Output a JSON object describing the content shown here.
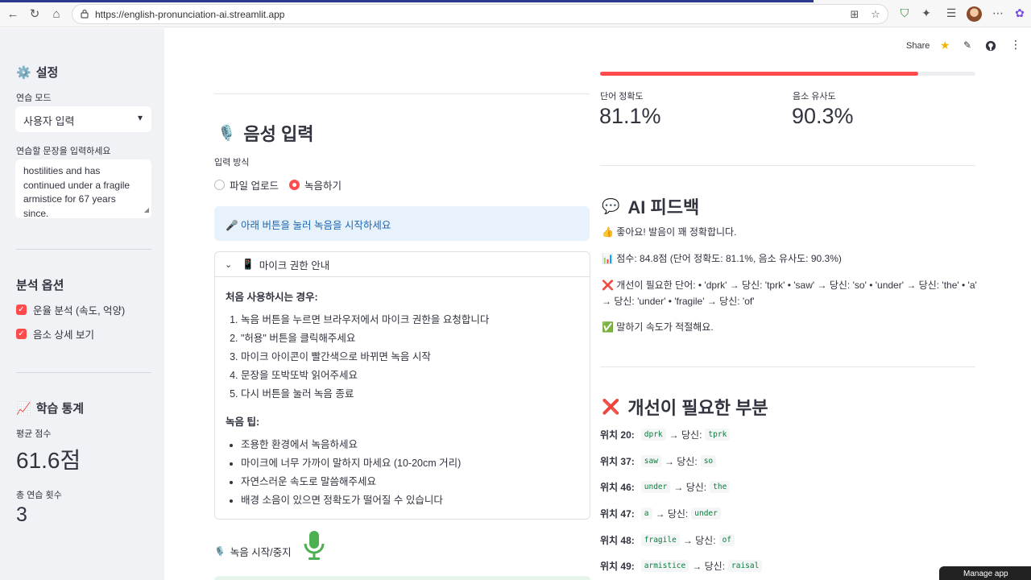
{
  "browser": {
    "url": "https://english-pronunciation-ai.streamlit.app"
  },
  "sidebar": {
    "settings_title": "설정",
    "mode_label": "연습 모드",
    "mode_value": "사용자 입력",
    "sentence_label": "연습할 문장을 입력하세요",
    "sentence_value": "hostilities and has continued under a fragile armistice for 67 years since.",
    "analysis_title": "분석 옵션",
    "options": [
      "운율 분석 (속도, 억양)",
      "음소 상세 보기"
    ],
    "stats_title": "학습 통계",
    "avg_label": "평균 점수",
    "avg_value": "61.6점",
    "count_label": "총 연습 횟수",
    "count_value": "3"
  },
  "header": {
    "share": "Share"
  },
  "voice": {
    "title": "음성 입력",
    "method_label": "입력 방식",
    "options": [
      "파일 업로드",
      "녹음하기"
    ],
    "selected": "녹음하기",
    "info": "🎤 아래 버튼을 눌러 녹음을 시작하세요",
    "expander_title": "마이크 권한 안내",
    "first_use_title": "처음 사용하시는 경우:",
    "steps": [
      "녹음 버튼을 누르면 브라우저에서 마이크 권한을 요청합니다",
      "\"허용\" 버튼을 클릭해주세요",
      "마이크 아이콘이 빨간색으로 바뀌면 녹음 시작",
      "문장을 또박또박 읽어주세요",
      "다시 버튼을 눌러 녹음 종료"
    ],
    "tips_title": "녹음 팁:",
    "tips": [
      "조용한 환경에서 녹음하세요",
      "마이크에 너무 가까이 말하지 마세요 (10-20cm 거리)",
      "자연스러운 속도로 말씀해주세요",
      "배경 소음이 있으면 정확도가 떨어질 수 있습니다"
    ],
    "record_label": "녹음 시작/중지"
  },
  "results": {
    "progress": 0.848,
    "word_acc_label": "단어 정확도",
    "word_acc_value": "81.1%",
    "phoneme_label": "음소 유사도",
    "phoneme_value": "90.3%",
    "feedback_title": "AI 피드백",
    "feedback_1": "👍 좋아요! 발음이 꽤 정확합니다.",
    "feedback_2": "📊 점수: 84.8점 (단어 정확도: 81.1%, 음소 유사도: 90.3%)",
    "feedback_3": "❌ 개선이 필요한 단어: • 'dprk' → 당신: 'tprk' • 'saw' → 당신: 'so' • 'under' → 당신: 'the' • 'a' → 당신: 'under' • 'fragile' → 당신: 'of'",
    "feedback_4": "✅ 말하기 속도가 적절해요.",
    "improve_title": "개선이 필요한 부분",
    "improve_items": [
      {
        "pos": "위치 20:",
        "expected": "dprk",
        "you_label": "→ 당신:",
        "actual": "tprk"
      },
      {
        "pos": "위치 37:",
        "expected": "saw",
        "you_label": "→ 당신:",
        "actual": "so"
      },
      {
        "pos": "위치 46:",
        "expected": "under",
        "you_label": "→ 당신:",
        "actual": "the"
      },
      {
        "pos": "위치 47:",
        "expected": "a",
        "you_label": "→ 당신:",
        "actual": "under"
      },
      {
        "pos": "위치 48:",
        "expected": "fragile",
        "you_label": "→ 당신:",
        "actual": "of"
      },
      {
        "pos": "위치 49:",
        "expected": "armistice",
        "you_label": "→ 당신:",
        "actual": "raisal"
      }
    ],
    "manage_app": "Manage app"
  }
}
